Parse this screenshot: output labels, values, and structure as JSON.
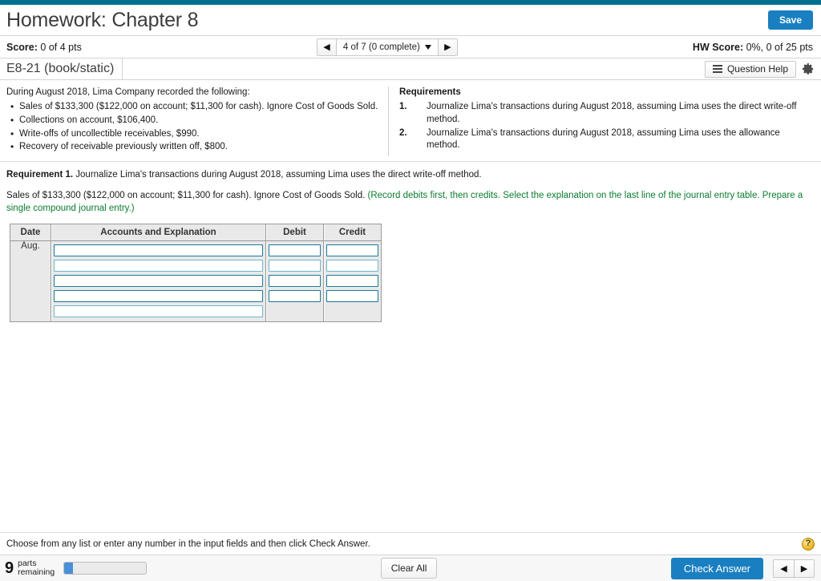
{
  "header": {
    "title": "Homework: Chapter 8",
    "save_label": "Save"
  },
  "score_bar": {
    "score_label": "Score:",
    "score_value": "0 of 4 pts",
    "nav_prev_icon": "◀",
    "nav_next_icon": "▶",
    "question_selector": "4 of 7 (0 complete)",
    "hw_score_label": "HW Score:",
    "hw_score_value": "0%, 0 of 25 pts"
  },
  "exercise_bar": {
    "exercise_id": "E8-21 (book/static)",
    "question_help_label": "Question Help",
    "list_icon": "list-icon",
    "gear_icon": "gear-icon"
  },
  "problem": {
    "intro": "During August 2018, Lima Company recorded the following:",
    "bullets": [
      "Sales of $133,300 ($122,000 on account; $11,300 for cash). Ignore Cost of Goods Sold.",
      "Collections on account, $106,400.",
      "Write-offs of uncollectible receivables, $990.",
      "Recovery of receivable previously written off, $800."
    ]
  },
  "requirements_panel": {
    "heading": "Requirements",
    "items": [
      {
        "num": "1.",
        "text": "Journalize Lima's transactions during August 2018, assuming Lima uses the direct write-off method."
      },
      {
        "num": "2.",
        "text": "Journalize Lima's transactions during August 2018, assuming Lima uses the allowance method."
      }
    ]
  },
  "requirement_body": {
    "label": "Requirement 1.",
    "statement": "Journalize Lima's transactions during August 2018, assuming Lima uses the direct write-off method.",
    "sub_text": "Sales of $133,300 ($122,000 on account; $11,300 for cash). Ignore Cost of Goods Sold. ",
    "sub_hint": "(Record debits first, then credits. Select the explanation on the last line of the journal entry table. Prepare a single compound journal entry.)"
  },
  "journal_table": {
    "columns": [
      "Date",
      "Accounts and Explanation",
      "Debit",
      "Credit"
    ],
    "date_value": "Aug.",
    "rows": [
      {
        "account": "",
        "debit": "",
        "credit": ""
      },
      {
        "account": "",
        "debit": "",
        "credit": ""
      },
      {
        "account": "",
        "debit": "",
        "credit": ""
      },
      {
        "account": "",
        "debit": "",
        "credit": ""
      },
      {
        "account": "",
        "debit": null,
        "credit": null
      }
    ]
  },
  "footer": {
    "hint": "Choose from any list or enter any number in the input fields and then click Check Answer.",
    "help_icon_glyph": "?",
    "parts_count": "9",
    "parts_label_line1": "parts",
    "parts_label_line2": "remaining",
    "progress_percent": 11,
    "clear_all_label": "Clear All",
    "check_answer_label": "Check Answer",
    "nav_prev_icon": "◀",
    "nav_next_icon": "▶"
  },
  "colors": {
    "teal_strip": "#00718f",
    "primary_blue": "#1a7fc1",
    "input_border": "#1a7c9c",
    "green_hint": "#0a7d2e",
    "help_gold": "#e8b21e"
  }
}
